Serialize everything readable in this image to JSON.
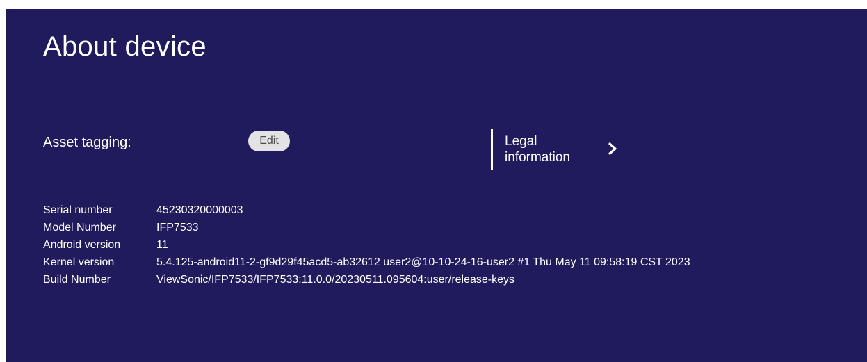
{
  "page": {
    "title": "About device"
  },
  "asset_tagging": {
    "label": "Asset tagging:",
    "edit_label": "Edit"
  },
  "legal": {
    "label_line1": "Legal",
    "label_line2": "information",
    "icon": "chevron-right-icon"
  },
  "info": [
    {
      "key": "Serial number",
      "value": "45230320000003"
    },
    {
      "key": "Model Number",
      "value": "IFP7533"
    },
    {
      "key": "Android version",
      "value": "11"
    },
    {
      "key": "Kernel version",
      "value": "5.4.125-android11-2-gf9d29f45acd5-ab32612  user2@10-10-24-16-user2 #1  Thu May 11 09:58:19 CST 2023"
    },
    {
      "key": "Build Number",
      "value": "ViewSonic/IFP7533/IFP7533:11.0.0/20230511.095604:user/release-keys"
    }
  ],
  "colors": {
    "background": "#1f1b5c",
    "text": "#ffffff",
    "button_bg": "#e3e3e6",
    "button_text": "#4a4a4a"
  }
}
